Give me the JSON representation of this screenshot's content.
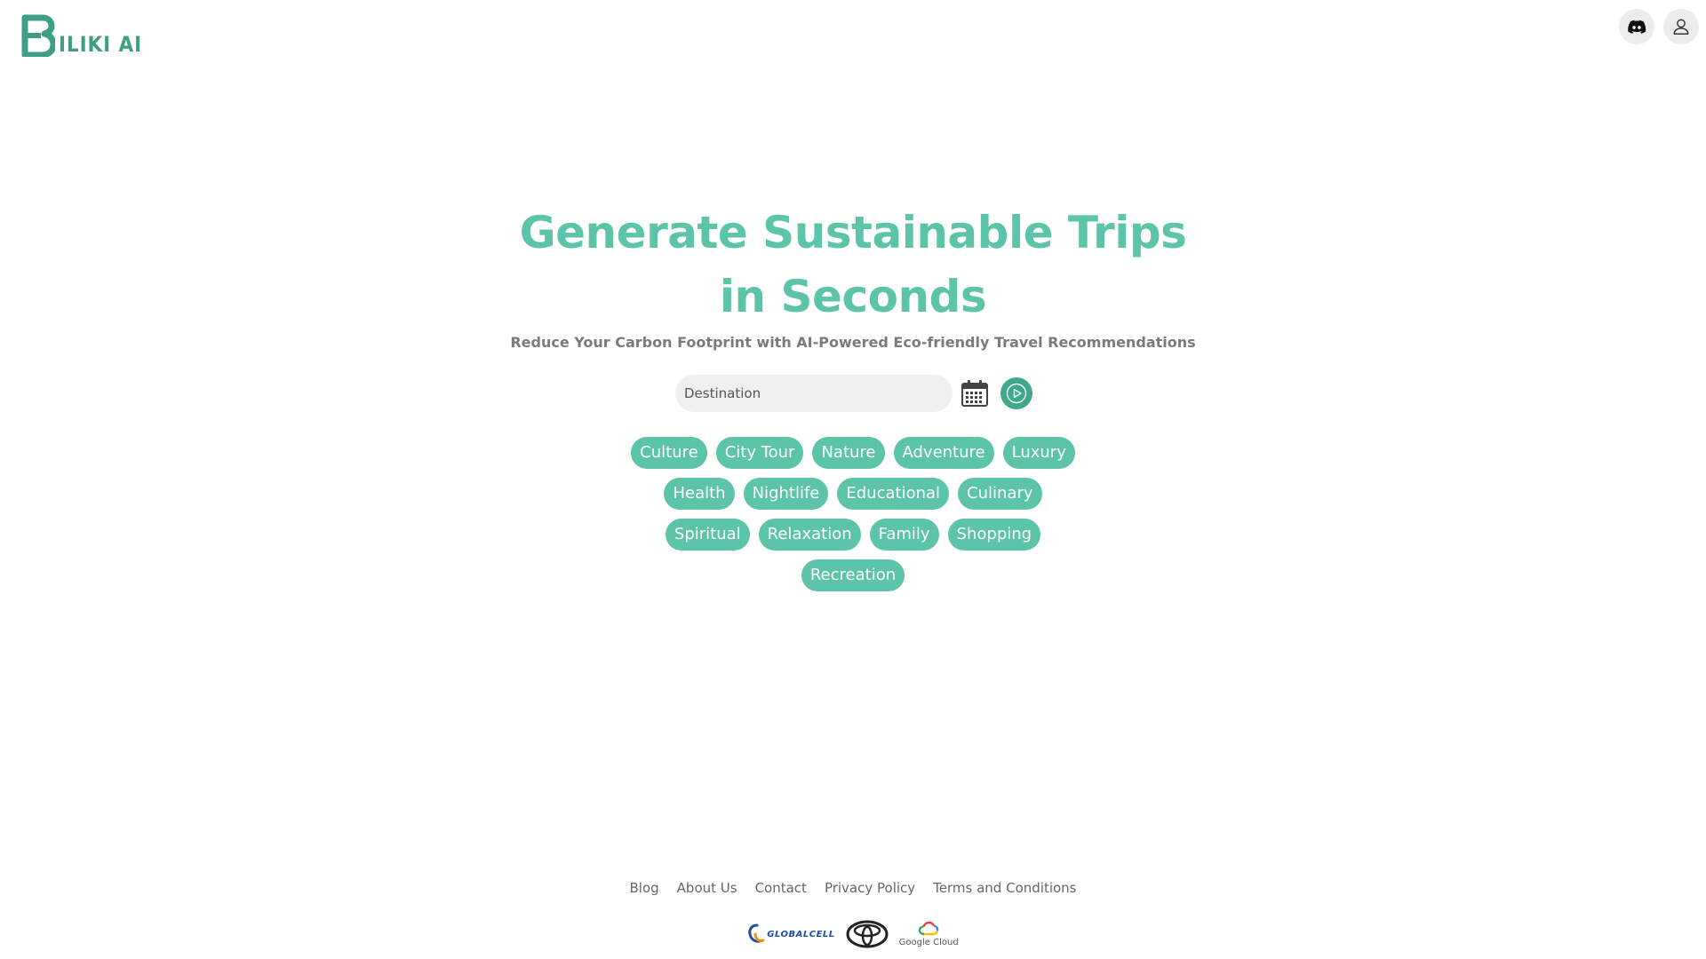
{
  "brand": {
    "name": "ILIKI AI",
    "mark_color": "#3f9e85"
  },
  "header": {
    "discord_icon": "discord-icon",
    "profile_icon": "user-icon"
  },
  "hero": {
    "title_line1": "Generate Sustainable Trips",
    "title_line2": "in Seconds",
    "subtitle": "Reduce Your Carbon Footprint with AI-Powered Eco-friendly Travel Recommendations",
    "accent_color": "#5cc4a9"
  },
  "search": {
    "placeholder": "Destination",
    "value": "",
    "calendar_icon": "calendar-icon",
    "submit_icon": "play-icon"
  },
  "tags": {
    "row1": [
      "Culture",
      "City Tour",
      "Nature",
      "Adventure",
      "Luxury"
    ],
    "row2": [
      "Health",
      "Nightlife",
      "Educational",
      "Culinary"
    ],
    "row3": [
      "Spiritual",
      "Relaxation",
      "Family",
      "Shopping"
    ],
    "row4": [
      "Recreation"
    ]
  },
  "footer": {
    "links": [
      "Blog",
      "About Us",
      "Contact",
      "Privacy Policy",
      "Terms and Conditions"
    ],
    "partners": {
      "globalcell": "GLOBALCELL",
      "toyota_icon": "toyota-logo",
      "google_cloud": "Google Cloud"
    }
  }
}
